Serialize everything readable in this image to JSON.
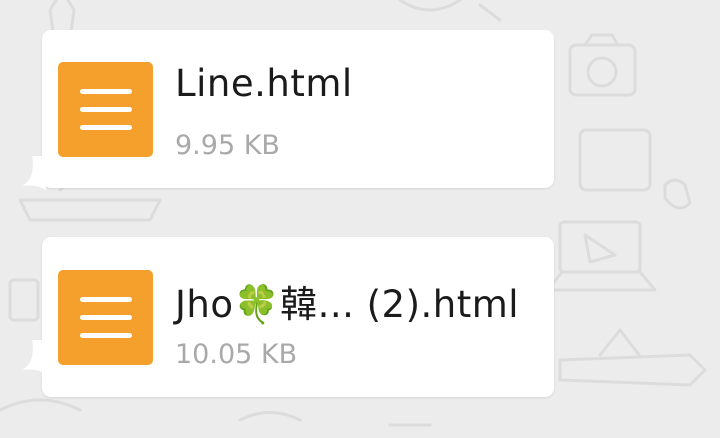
{
  "messages": [
    {
      "file_name": "Line.html",
      "file_size": "9.95 KB",
      "icon": "document-lines-icon"
    },
    {
      "file_name": "Jho🍀韓... (2).html",
      "file_size": "10.05 KB",
      "icon": "document-lines-icon"
    }
  ],
  "colors": {
    "background": "#ececec",
    "bubble": "#ffffff",
    "file_icon": "#f5a02c",
    "file_name_text": "#1b1b1b",
    "file_size_text": "#a9a9a9"
  }
}
